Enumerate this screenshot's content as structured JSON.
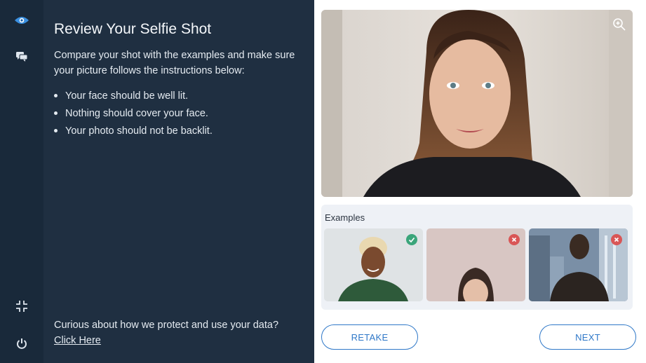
{
  "sidebar": {
    "items": [
      {
        "name": "eye-icon",
        "active": true
      },
      {
        "name": "chat-icon",
        "active": false
      },
      {
        "name": "compress-icon",
        "active": false
      },
      {
        "name": "power-icon",
        "active": false
      }
    ]
  },
  "left": {
    "title": "Review Your Selfie Shot",
    "intro": "Compare your shot with the examples and make sure your picture follows the instructions below:",
    "bullets": [
      "Your face should be well lit.",
      "Nothing should cover your face.",
      "Your photo should not be backlit."
    ],
    "footer_text": "Curious about how we protect and use your data?",
    "footer_link": "Click Here"
  },
  "right": {
    "examples_label": "Examples",
    "examples": [
      {
        "status": "good",
        "icon": "check-icon"
      },
      {
        "status": "bad",
        "icon": "x-icon"
      },
      {
        "status": "bad",
        "icon": "x-icon"
      }
    ],
    "retake_label": "RETAKE",
    "next_label": "NEXT"
  },
  "colors": {
    "sidebar_bg": "#19293a",
    "panel_bg": "#1f2f41",
    "accent": "#2f78c8",
    "good": "#3aa57a",
    "bad": "#d95656"
  }
}
